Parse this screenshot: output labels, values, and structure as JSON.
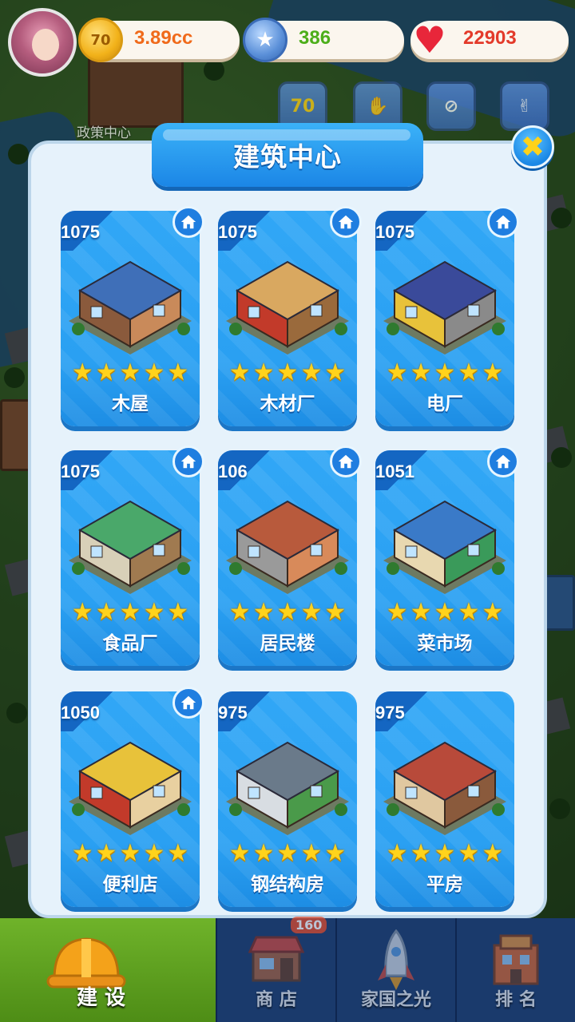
{
  "resources": {
    "coins": "3.89cc",
    "coin_icon_text": "70",
    "stars": "386",
    "hearts": "22903"
  },
  "background": {
    "event_icon_text": "70",
    "policy_label": "政策中心"
  },
  "panel": {
    "title": "建筑中心",
    "close_icon": "✖"
  },
  "buildings": [
    {
      "name": "木屋",
      "level": "1075",
      "stars": 5,
      "owned": true
    },
    {
      "name": "木材厂",
      "level": "1075",
      "stars": 5,
      "owned": true
    },
    {
      "name": "电厂",
      "level": "1075",
      "stars": 5,
      "owned": true
    },
    {
      "name": "食品厂",
      "level": "1075",
      "stars": 5,
      "owned": true
    },
    {
      "name": "居民楼",
      "level": "106",
      "stars": 5,
      "owned": true
    },
    {
      "name": "菜市场",
      "level": "1051",
      "stars": 5,
      "owned": true
    },
    {
      "name": "便利店",
      "level": "1050",
      "stars": 5,
      "owned": true
    },
    {
      "name": "钢结构房",
      "level": "975",
      "stars": 5,
      "owned": false
    },
    {
      "name": "平房",
      "level": "975",
      "stars": 5,
      "owned": false
    }
  ],
  "bottom_nav": {
    "build": "建 设",
    "shop": "商 店",
    "shop_badge": "160",
    "glory": "家国之光",
    "rank": "排 名"
  },
  "colors": {
    "card_blue": "#2aa0f2",
    "panel_bg": "#e6f2fb",
    "star_gold": "#ffd31c",
    "nav_active": "#5a9e1e"
  }
}
